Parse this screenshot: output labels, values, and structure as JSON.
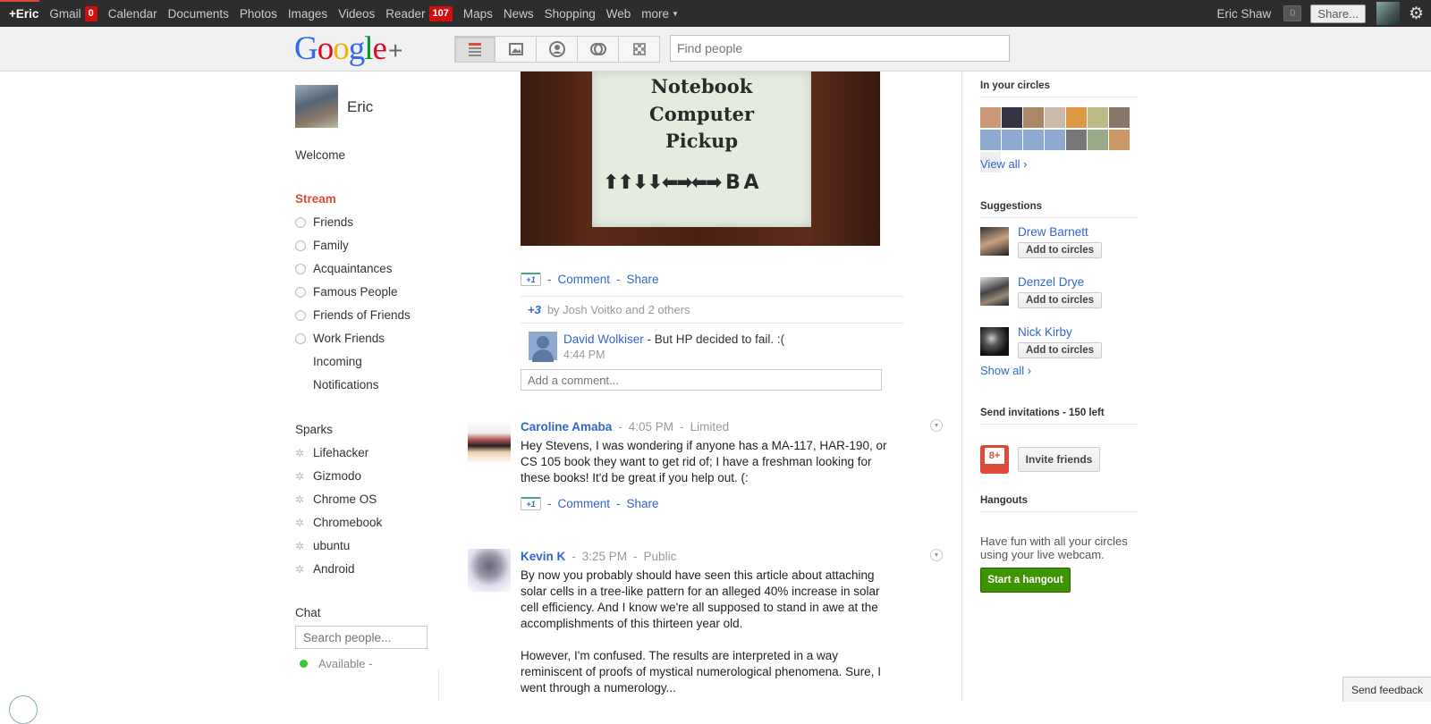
{
  "topbar": {
    "nav": [
      {
        "label": "+Eric",
        "badge": null
      },
      {
        "label": "Gmail",
        "badge": "0"
      },
      {
        "label": "Calendar",
        "badge": null
      },
      {
        "label": "Documents",
        "badge": null
      },
      {
        "label": "Photos",
        "badge": null
      },
      {
        "label": "Images",
        "badge": null
      },
      {
        "label": "Videos",
        "badge": null
      },
      {
        "label": "Reader",
        "badge": "107"
      },
      {
        "label": "Maps",
        "badge": null
      },
      {
        "label": "News",
        "badge": null
      },
      {
        "label": "Shopping",
        "badge": null
      },
      {
        "label": "Web",
        "badge": null
      },
      {
        "label": "more",
        "badge": null
      }
    ],
    "user_name": "Eric Shaw",
    "notification_count": "0",
    "share_label": "Share...",
    "accent_color": "#dd4b39"
  },
  "header": {
    "logo_text": "Google",
    "logo_plus": "+",
    "nav_icons": [
      "stream-icon",
      "photos-icon",
      "profile-icon",
      "circles-icon",
      "games-icon"
    ],
    "find_people_placeholder": "Find people"
  },
  "left": {
    "profile_name": "Eric",
    "welcome": "Welcome",
    "stream_label": "Stream",
    "circles": [
      "Friends",
      "Family",
      "Acquaintances",
      "Famous People",
      "Friends of Friends",
      "Work Friends"
    ],
    "incoming": "Incoming",
    "notifications": "Notifications",
    "sparks_label": "Sparks",
    "sparks": [
      "Lifehacker",
      "Gizmodo",
      "Chrome OS",
      "Chromebook",
      "ubuntu",
      "Android"
    ],
    "chat_label": "Chat",
    "chat_search_placeholder": "Search people...",
    "availability": "Available -"
  },
  "stream": {
    "photo_post": {
      "sign_lines": [
        "Notebook",
        "Computer",
        "Pickup"
      ],
      "sign_arrows": "⬆⬆⬇⬇⬅➡⬅➡ B A",
      "plus_one": "+1",
      "comment": "Comment",
      "share": "Share",
      "plusones_count": "+3",
      "plusones_by": "by Josh Voitko and 2 others",
      "comment_author": "David Wolkiser",
      "comment_text": " - But HP decided to fail. :(",
      "comment_time": "4:44 PM",
      "add_comment_placeholder": "Add a comment..."
    },
    "posts": [
      {
        "author": "Caroline Amaba",
        "time": "4:05 PM",
        "visibility": "Limited",
        "body": "Hey Stevens, I was wondering if anyone has a MA-117, HAR-190, or CS 105 book they want to get rid of; I have a freshman looking for these books! It'd be great if you help out. (:",
        "plus_one": "+1",
        "comment": "Comment",
        "share": "Share"
      },
      {
        "author": "Kevin K",
        "time": "3:25 PM",
        "visibility": "Public",
        "body_p1": "By now you probably should have seen this article about attaching solar cells in a tree-like pattern for an alleged 40% increase in solar cell efficiency. And I know we're all supposed to stand in awe at the accomplishments of this thirteen year old.",
        "body_p2": "However, I'm confused. The results are interpreted in a way reminiscent of proofs of mystical numerological phenomena. Sure, I went through a numerology..."
      }
    ]
  },
  "right": {
    "in_circles_title": "In your circles",
    "view_all": "View all ›",
    "suggestions_title": "Suggestions",
    "suggestions": [
      {
        "name": "Drew Barnett",
        "button": "Add to circles"
      },
      {
        "name": "Denzel Drye",
        "button": "Add to circles"
      },
      {
        "name": "Nick Kirby",
        "button": "Add to circles"
      }
    ],
    "show_all": "Show all ›",
    "invitations_title": "Send invitations - 150 left",
    "invite_button": "Invite friends",
    "hangouts_title": "Hangouts",
    "hangouts_text": "Have fun with all your circles using your live webcam.",
    "hangout_button": "Start a hangout",
    "hangout_color": "#3d9400"
  },
  "send_feedback": "Send feedback"
}
